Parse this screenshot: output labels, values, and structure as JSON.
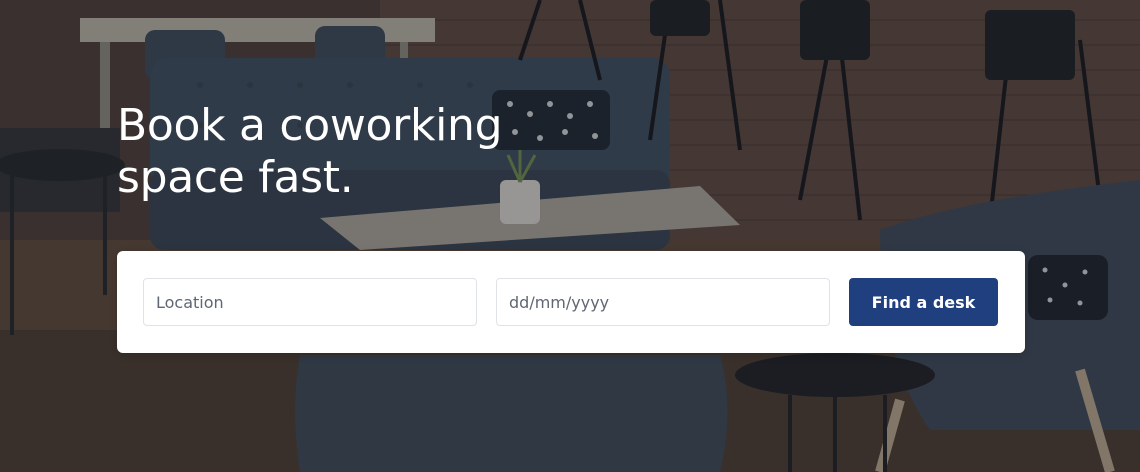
{
  "hero": {
    "headline": "Book a coworking space fast."
  },
  "search": {
    "location_placeholder": "Location",
    "date_placeholder": "dd/mm/yyyy",
    "submit_label": "Find a desk"
  },
  "colors": {
    "button_bg": "#1f3f7e",
    "button_text": "#ffffff",
    "card_bg": "#ffffff",
    "headline_text": "#ffffff"
  }
}
